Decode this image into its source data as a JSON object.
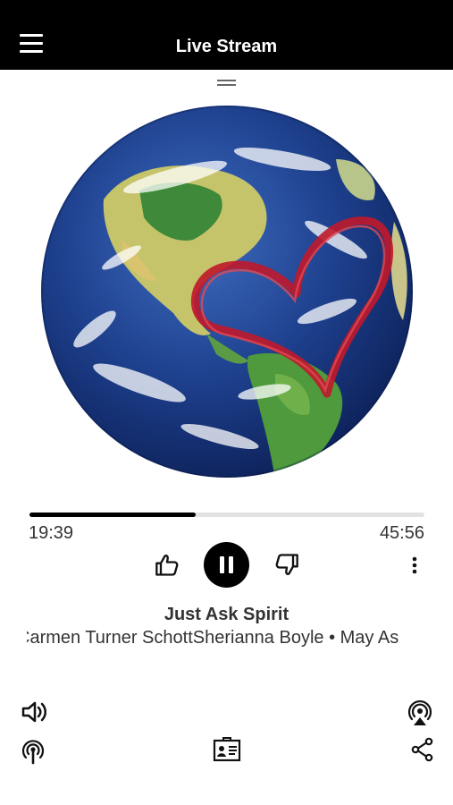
{
  "header": {
    "title": "Live Stream",
    "menu_icon": "hamburger-menu-icon"
  },
  "player": {
    "elapsed": "19:39",
    "total": "45:56",
    "progress_fraction": 0.42,
    "state_icon": "pause-icon"
  },
  "track": {
    "title": "Just Ask Spirit",
    "subtitle": "Carmen Turner SchottSherianna Boyle • May As"
  },
  "icons": {
    "volume": "speaker-icon",
    "airplay": "airplay-icon",
    "podcast": "podcast-antenna-icon",
    "card": "contact-card-icon",
    "share": "share-icon"
  },
  "colors": {
    "header_bg": "#000000",
    "accent": "#000000",
    "heart": "#c0182b"
  }
}
